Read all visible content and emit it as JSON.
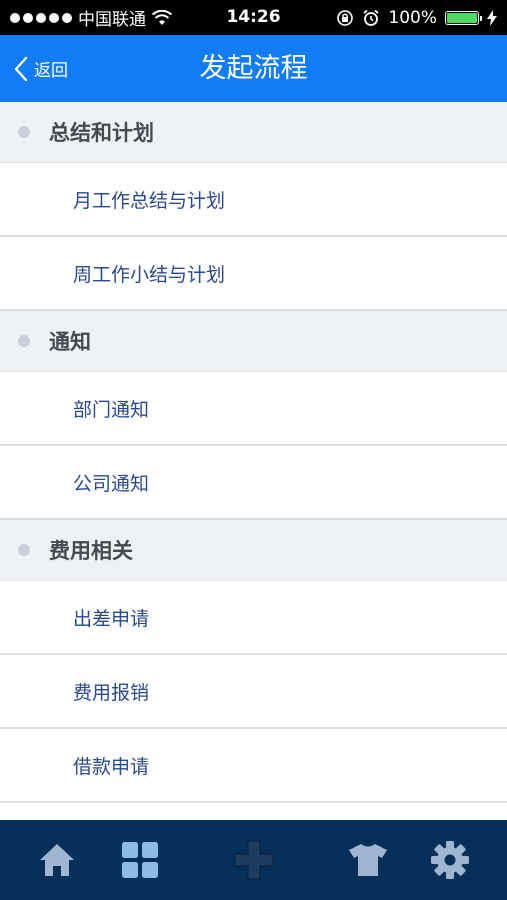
{
  "status_bar": {
    "carrier": "中国联通",
    "time": "14:26",
    "battery": "100%",
    "battery_level": 1.0
  },
  "nav": {
    "back_label": "返回",
    "title": "发起流程"
  },
  "sections": [
    {
      "title": "总结和计划",
      "items": [
        "月工作总结与计划",
        "周工作小结与计划"
      ]
    },
    {
      "title": "通知",
      "items": [
        "部门通知",
        "公司通知"
      ]
    },
    {
      "title": "费用相关",
      "items": [
        "出差申请",
        "费用报销",
        "借款申请"
      ]
    }
  ],
  "tab_bar": {
    "tabs": [
      {
        "icon": "home-icon"
      },
      {
        "icon": "grid-icon"
      },
      {
        "icon": "plus-icon"
      },
      {
        "icon": "shirt-icon"
      },
      {
        "icon": "gear-icon"
      }
    ]
  },
  "colors": {
    "nav_bg": "#127cf8",
    "tab_bar_bg": "#06305a",
    "item_text": "#2a4a8e",
    "section_bg": "#eff2f5"
  }
}
